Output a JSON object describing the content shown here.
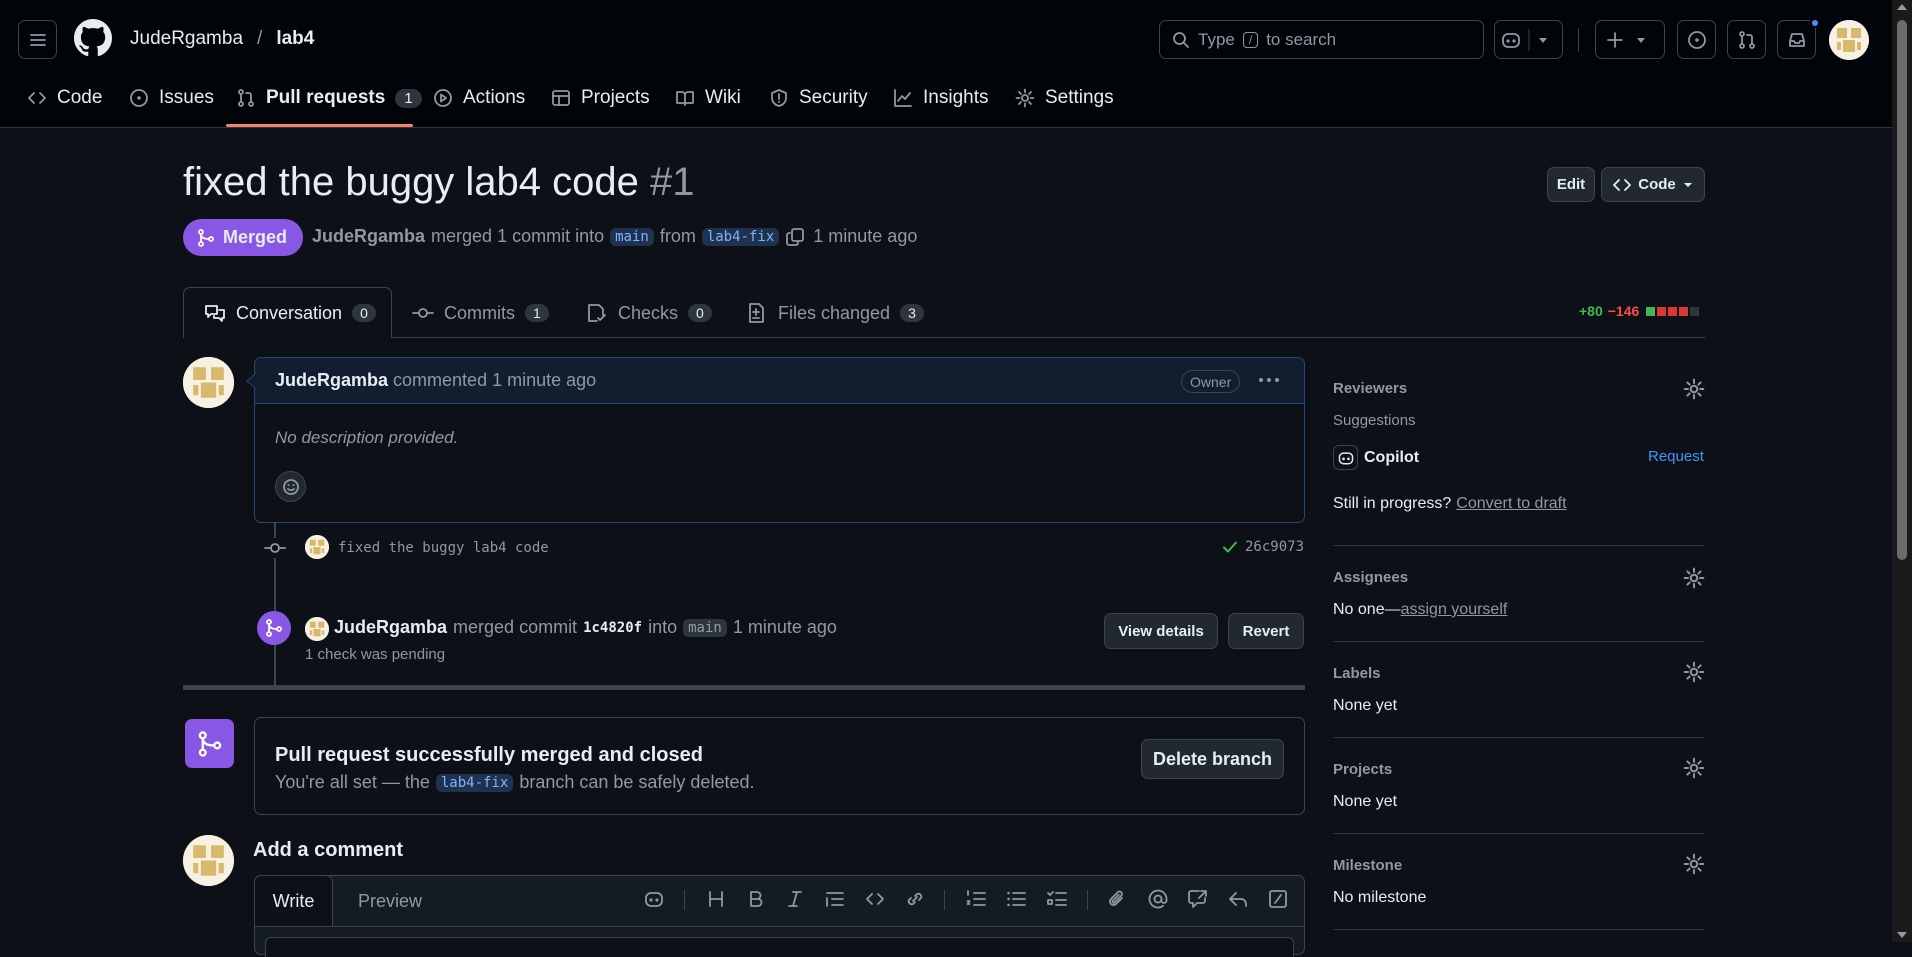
{
  "header": {
    "owner": "JudeRgamba",
    "separator": "/",
    "repo": "lab4",
    "search_prefix": "Type",
    "search_key": "/",
    "search_suffix": "to search",
    "tabs": [
      {
        "label": "Code",
        "icon": "code-icon"
      },
      {
        "label": "Issues",
        "icon": "issue-icon"
      },
      {
        "label": "Pull requests",
        "icon": "pull-request-icon",
        "count": "1",
        "selected": true
      },
      {
        "label": "Actions",
        "icon": "play-icon"
      },
      {
        "label": "Projects",
        "icon": "table-icon"
      },
      {
        "label": "Wiki",
        "icon": "book-icon"
      },
      {
        "label": "Security",
        "icon": "shield-icon"
      },
      {
        "label": "Insights",
        "icon": "graph-icon"
      },
      {
        "label": "Settings",
        "icon": "gear-icon"
      }
    ]
  },
  "pr": {
    "title": "fixed the buggy lab4 code",
    "number": "#1",
    "state": "Merged",
    "author": "JudeRgamba",
    "meta_merged": "merged 1 commit into",
    "base": "main",
    "meta_from": "from",
    "head": "lab4-fix",
    "time": "1 minute ago",
    "edit_label": "Edit",
    "code_label": "Code",
    "tabs": [
      {
        "label": "Conversation",
        "count": "0",
        "icon": "comment-discussion-icon"
      },
      {
        "label": "Commits",
        "count": "1",
        "icon": "commit-icon"
      },
      {
        "label": "Checks",
        "count": "0",
        "icon": "checklist-icon"
      },
      {
        "label": "Files changed",
        "count": "3",
        "icon": "file-diff-icon"
      }
    ],
    "additions": "+80",
    "deletions": "−146"
  },
  "comment": {
    "author": "JudeRgamba",
    "action": "commented",
    "time": "1 minute ago",
    "badge": "Owner",
    "body": "No description provided."
  },
  "commit": {
    "message": "fixed the buggy lab4 code",
    "sha": "26c9073"
  },
  "merge_event": {
    "author": "JudeRgamba",
    "action": "merged commit",
    "sha": "1c4820f",
    "into": "into",
    "base": "main",
    "time": "1 minute ago",
    "checks": "1 check was pending",
    "view_details": "View details",
    "revert": "Revert"
  },
  "merged_box": {
    "title": "Pull request successfully merged and closed",
    "text_pre": "You're all set — the",
    "branch": "lab4-fix",
    "text_post": "branch can be safely deleted.",
    "delete_label": "Delete branch"
  },
  "add_comment": {
    "title": "Add a comment",
    "write": "Write",
    "preview": "Preview"
  },
  "sidebar": {
    "reviewers": "Reviewers",
    "suggestions": "Suggestions",
    "copilot": "Copilot",
    "request": "Request",
    "in_progress": "Still in progress?",
    "convert": "Convert to draft",
    "assignees": "Assignees",
    "assignees_none": "No one—",
    "assign_yourself": "assign yourself",
    "labels": "Labels",
    "labels_none": "None yet",
    "projects": "Projects",
    "projects_none": "None yet",
    "milestone": "Milestone",
    "milestone_none": "No milestone"
  },
  "colors": {
    "merged": "#8957e5",
    "link": "#4493f8",
    "added": "#3fb950",
    "deleted": "#f85149"
  }
}
